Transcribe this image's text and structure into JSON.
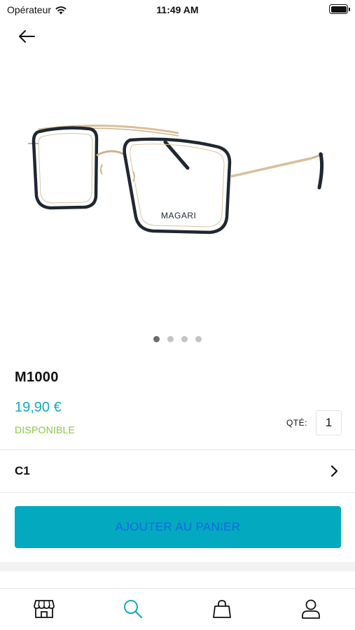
{
  "status_bar": {
    "carrier": "Opérateur",
    "time": "11:49 AM"
  },
  "header": {
    "back_icon": "arrow-left-icon"
  },
  "product": {
    "image_brand": "MAGARI",
    "name": "M1000",
    "price": "19,90 €",
    "availability": "DISPONIBLE",
    "quantity_label": "QTÉ:",
    "quantity_value": "1",
    "variant": "C1",
    "add_to_cart_label": "AJOUTER AU PANIER"
  },
  "carousel": {
    "count": 4,
    "active_index": 0
  },
  "tab_bar": {
    "items": [
      {
        "icon": "store-icon"
      },
      {
        "icon": "search-icon"
      },
      {
        "icon": "shopping-bag-icon"
      },
      {
        "icon": "user-icon"
      }
    ]
  },
  "colors": {
    "accent": "#17a9c0",
    "button_bg": "#03a9bf",
    "button_text": "#1769e4",
    "available": "#86c93e"
  }
}
